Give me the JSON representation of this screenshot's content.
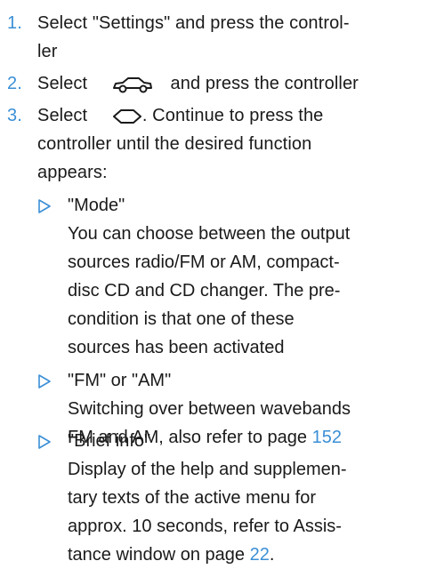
{
  "steps": [
    {
      "number": "1.",
      "lines": [
        "Select \"Settings\" and press the control-",
        "ler"
      ]
    },
    {
      "number": "2.",
      "before_icon": "Select",
      "icon": "car-icon",
      "after_icon": "and press the controller"
    },
    {
      "number": "3.",
      "before_icon": "Select",
      "icon": "diamond-icon",
      "after_icon": ". Continue to press the",
      "lines": [
        "controller until the desired function",
        "appears:"
      ]
    }
  ],
  "options": [
    {
      "title": "\"Mode\"",
      "lines": [
        "You can choose between the output",
        "sources radio/FM or AM, compact-",
        "disc CD and CD changer. The pre-",
        "condition is that one of these",
        "sources has been activated"
      ]
    },
    {
      "title": "\"FM\" or \"AM\"",
      "lines": [
        "Switching over between wavebands"
      ],
      "last_line_prefix": "FM and AM, also refer to page ",
      "page_ref": "152"
    },
    {
      "title": "\"Brief info\"",
      "lines": [
        "Display of the help and supplemen-",
        "tary texts of the active menu for",
        "approx. 10 seconds, refer to Assis-"
      ],
      "last_line_prefix": "tance window on page ",
      "page_ref": "22",
      "last_line_suffix": "."
    }
  ],
  "colors": {
    "accent": "#3b8fd6",
    "text": "#1a1a1a"
  }
}
